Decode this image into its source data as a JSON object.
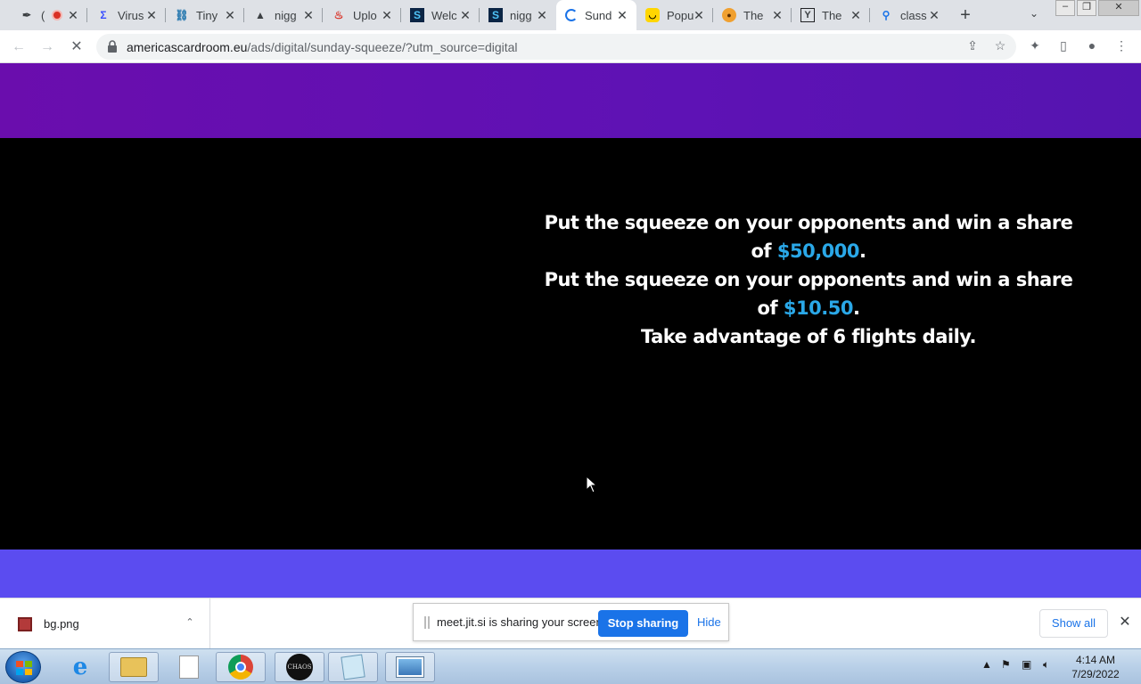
{
  "browser": {
    "tabs": [
      {
        "title": "(",
        "icon": "feather-icon"
      },
      {
        "title": "Virus",
        "icon": "sigma-icon"
      },
      {
        "title": "Tiny",
        "icon": "link-icon"
      },
      {
        "title": "nigg",
        "icon": "mountain-icon"
      },
      {
        "title": "Uplo",
        "icon": "flame-icon"
      },
      {
        "title": "Welc",
        "icon": "s-icon"
      },
      {
        "title": "nigg",
        "icon": "s-icon"
      },
      {
        "title": "Sund",
        "icon": "loading-spinner-icon"
      },
      {
        "title": "Popu",
        "icon": "smiley-icon"
      },
      {
        "title": "The",
        "icon": "face-icon"
      },
      {
        "title": "The",
        "icon": "y-icon"
      },
      {
        "title": "class",
        "icon": "search-icon"
      }
    ],
    "url_host": "americascardroom.eu",
    "url_rest": "/ads/digital/sunday-squeeze/?utm_source=digital"
  },
  "page": {
    "line1_prefix": "Put the squeeze on your opponents and win a share of ",
    "line1_amount": "$50,000",
    "line1_suffix": ".",
    "line2_prefix": "Put the squeeze on your opponents and win a share of ",
    "line2_amount": "$10.50",
    "line2_suffix": ".",
    "line3": "Take advantage of 6 flights daily.",
    "colors": {
      "top_band": "#6a0dad",
      "bottom_band": "#5b4cf0",
      "amount": "#2aa8e8"
    }
  },
  "downloads": {
    "file_name": "bg.png",
    "show_all": "Show all"
  },
  "share_notice": {
    "text": "meet.jit.si is sharing your screen.",
    "stop_label": "Stop sharing",
    "hide_label": "Hide"
  },
  "taskbar": {
    "chaos_label": "CHAOS",
    "time": "4:14 AM",
    "date": "7/29/2022"
  }
}
